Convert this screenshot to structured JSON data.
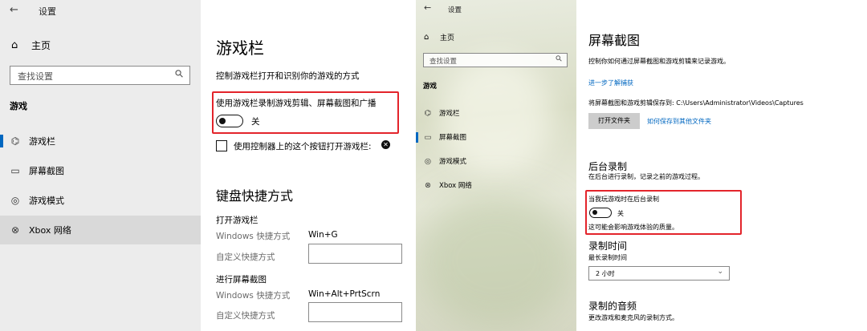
{
  "left": {
    "sidebar": {
      "back": "←",
      "app_title": "设置",
      "home": {
        "icon": "home-icon",
        "glyph": "⌂",
        "label": "主页"
      },
      "search_placeholder": "查找设置",
      "category": "游戏",
      "items": [
        {
          "label": "游戏栏",
          "icon": "game-controller-icon",
          "glyph": "⌬"
        },
        {
          "label": "屏幕截图",
          "icon": "capture-icon",
          "glyph": "▭"
        },
        {
          "label": "游戏模式",
          "icon": "game-mode-icon",
          "glyph": "◎"
        },
        {
          "label": "Xbox 网络",
          "icon": "xbox-icon",
          "glyph": "⊗"
        }
      ]
    },
    "main": {
      "title": "游戏栏",
      "description": "控制游戏栏打开和识别你的游戏的方式",
      "record_option": {
        "label": "使用游戏栏录制游戏剪辑、屏幕截图和广播",
        "state": "关"
      },
      "controller_option": "使用控制器上的这个按钮打开游戏栏:",
      "shortcuts_title": "键盘快捷方式",
      "groups": [
        {
          "title": "打开游戏栏",
          "windows_label": "Windows 快捷方式",
          "windows_value": "Win+G",
          "custom_label": "自定义快捷方式"
        },
        {
          "title": "进行屏幕截图",
          "windows_label": "Windows 快捷方式",
          "windows_value": "Win+Alt+PrtScrn",
          "custom_label": "自定义快捷方式"
        }
      ]
    }
  },
  "right": {
    "sidebar": {
      "back": "←",
      "app_title": "设置",
      "home": {
        "icon": "home-icon",
        "glyph": "⌂",
        "label": "主页"
      },
      "search_placeholder": "查找设置",
      "category": "游戏",
      "items": [
        {
          "label": "游戏栏",
          "icon": "game-controller-icon",
          "glyph": "⌬"
        },
        {
          "label": "屏幕截图",
          "icon": "capture-icon",
          "glyph": "▭"
        },
        {
          "label": "游戏模式",
          "icon": "game-mode-icon",
          "glyph": "◎"
        },
        {
          "label": "Xbox 网络",
          "icon": "xbox-icon",
          "glyph": "⊗"
        }
      ]
    },
    "main": {
      "title": "屏幕截图",
      "description": "控制你如何通过屏幕截图和游戏剪辑来记录游戏。",
      "learn_more": "进一步了解捕获",
      "save_path": "将屏幕截图和游戏剪辑保存到: C:\\Users\\Administrator\\Videos\\Captures",
      "open_folder_button": "打开文件夹",
      "save_elsewhere_link": "如何保存到其他文件夹",
      "bg_title": "后台录制",
      "bg_desc": "在后台进行录制，记录之前的游戏过程。",
      "bg_option": {
        "label": "当我玩游戏时在后台录制",
        "state": "关",
        "note": "这可能会影响游戏体验的质量。"
      },
      "rec_time_title": "录制时间",
      "rec_time_label": "最长录制时间",
      "rec_time_value": "2 小时",
      "audio_title": "录制的音频",
      "audio_desc": "更改游戏和麦克风的录制方式。"
    }
  },
  "colors": {
    "highlight": "#e3242b",
    "accent": "#0067c0",
    "sidebar_bg": "#ececec"
  }
}
